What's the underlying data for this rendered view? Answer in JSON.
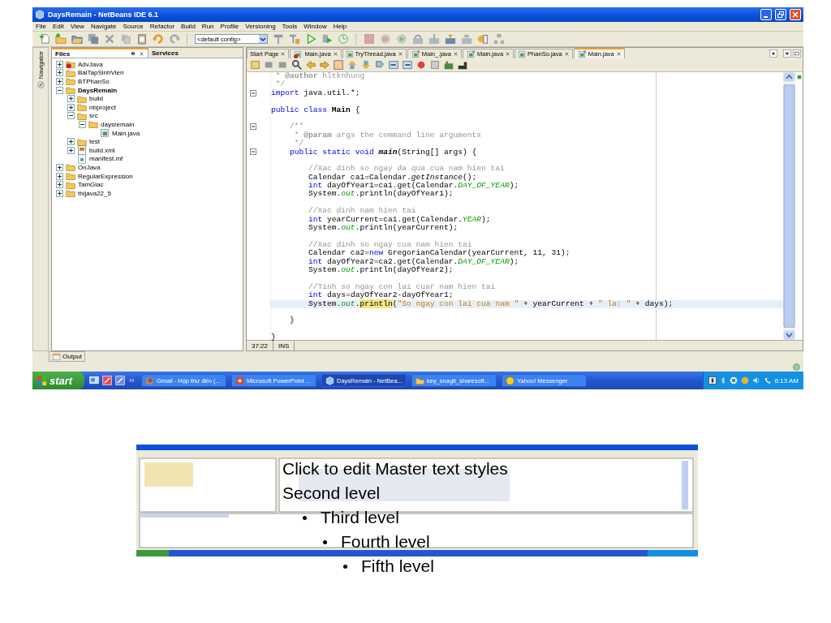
{
  "window": {
    "title": "DaysRemain - NetBeans IDE 6.1"
  },
  "menu": [
    "File",
    "Edit",
    "View",
    "Navigate",
    "Source",
    "Refactor",
    "Build",
    "Run",
    "Profile",
    "Versioning",
    "Tools",
    "Window",
    "Help"
  ],
  "toolbar": {
    "config": "<default config>"
  },
  "navigator": {
    "label": "Navigator"
  },
  "files_panel": {
    "tabs": [
      {
        "label": "Files",
        "selected": true
      },
      {
        "label": "Services",
        "selected": false
      }
    ],
    "tree": [
      {
        "label": "AdvJava",
        "kind": "error-project",
        "expanded": false
      },
      {
        "label": "BaiTapSinhVien",
        "kind": "project",
        "expanded": false
      },
      {
        "label": "BTPhanSo",
        "kind": "project",
        "expanded": false
      },
      {
        "label": "DaysRemain",
        "kind": "main-project",
        "expanded": true,
        "children": [
          {
            "label": "build",
            "kind": "folder",
            "expanded": false
          },
          {
            "label": "nbproject",
            "kind": "folder",
            "expanded": false
          },
          {
            "label": "src",
            "kind": "folder",
            "expanded": true,
            "children": [
              {
                "label": "daysremain",
                "kind": "folder",
                "expanded": true,
                "children": [
                  {
                    "label": "Main.java",
                    "kind": "java"
                  }
                ]
              }
            ]
          },
          {
            "label": "test",
            "kind": "folder",
            "expanded": false
          },
          {
            "label": "build.xml",
            "kind": "xml",
            "expanded": false
          },
          {
            "label": "manifest.mf",
            "kind": "manifest"
          }
        ]
      },
      {
        "label": "OnJava",
        "kind": "project",
        "expanded": false
      },
      {
        "label": "RegularExpression",
        "kind": "project",
        "expanded": false
      },
      {
        "label": "TamGiac",
        "kind": "project",
        "expanded": false
      },
      {
        "label": "thijava22_5",
        "kind": "project",
        "expanded": false
      }
    ]
  },
  "editor": {
    "tabs": [
      {
        "label": "Start Page",
        "kind": "page",
        "selected": false
      },
      {
        "label": "Main.java",
        "kind": "error-java",
        "selected": false
      },
      {
        "label": "TryThread.java",
        "kind": "java",
        "selected": false
      },
      {
        "label": "Main_.java",
        "kind": "run-java",
        "selected": false
      },
      {
        "label": "Main.java",
        "kind": "run-java",
        "selected": false
      },
      {
        "label": "PhanSo.java",
        "kind": "java",
        "selected": false
      },
      {
        "label": "Main.java",
        "kind": "run-java",
        "selected": true
      }
    ],
    "lines": [
      {
        "fold": false,
        "current": false,
        "segments": [
          {
            "kind": "comment",
            "text": " * "
          },
          {
            "kind": "doc-tag",
            "text": "@author"
          },
          {
            "kind": "comment",
            "text": " hltknhung"
          }
        ]
      },
      {
        "fold": false,
        "current": false,
        "segments": [
          {
            "kind": "comment",
            "text": " */"
          }
        ]
      },
      {
        "fold": true,
        "current": false,
        "segments": [
          {
            "kind": "keyword",
            "text": "import"
          },
          {
            "kind": "plain",
            "text": " java.util.*;"
          }
        ]
      },
      {
        "fold": false,
        "current": false
      },
      {
        "fold": false,
        "current": false,
        "segments": [
          {
            "kind": "keyword",
            "text": "public class "
          },
          {
            "kind": "bold",
            "text": "Main"
          },
          {
            "kind": "plain",
            "text": " {"
          }
        ]
      },
      {
        "fold": false,
        "current": false
      },
      {
        "fold": true,
        "current": false,
        "segments": [
          {
            "kind": "comment",
            "text": "    /**"
          }
        ]
      },
      {
        "fold": false,
        "current": false,
        "segments": [
          {
            "kind": "comment",
            "text": "     * "
          },
          {
            "kind": "doc-tag",
            "text": "@param"
          },
          {
            "kind": "comment",
            "text": " args the command line arguments"
          }
        ]
      },
      {
        "fold": false,
        "current": false,
        "segments": [
          {
            "kind": "comment",
            "text": "     */"
          }
        ]
      },
      {
        "fold": true,
        "current": false,
        "segments": [
          {
            "kind": "keyword",
            "text": "    public static void "
          },
          {
            "kind": "bold-italic",
            "text": "main"
          },
          {
            "kind": "plain",
            "text": "(String[] args) {"
          }
        ]
      },
      {
        "fold": false,
        "current": false
      },
      {
        "fold": false,
        "current": false,
        "segments": [
          {
            "kind": "comment",
            "text": "        //Xac dinh so ngay da qua cua nam hien tai"
          }
        ]
      },
      {
        "fold": false,
        "current": false,
        "segments": [
          {
            "kind": "plain",
            "text": "        Calendar ca1=Calendar."
          },
          {
            "kind": "italic",
            "text": "getInstance"
          },
          {
            "kind": "plain",
            "text": "();"
          }
        ]
      },
      {
        "fold": false,
        "current": false,
        "segments": [
          {
            "kind": "keyword",
            "text": "        int"
          },
          {
            "kind": "plain",
            "text": " dayOfYear1=ca1.get(Calendar."
          },
          {
            "kind": "field",
            "text": "DAY_OF_YEAR"
          },
          {
            "kind": "plain",
            "text": ");"
          }
        ]
      },
      {
        "fold": false,
        "current": false,
        "segments": [
          {
            "kind": "plain",
            "text": "        System."
          },
          {
            "kind": "field",
            "text": "out"
          },
          {
            "kind": "plain",
            "text": ".println(dayOfYear1);"
          }
        ]
      },
      {
        "fold": false,
        "current": false
      },
      {
        "fold": false,
        "current": false,
        "segments": [
          {
            "kind": "comment",
            "text": "        //Xac dinh nam hien tai"
          }
        ]
      },
      {
        "fold": false,
        "current": false,
        "segments": [
          {
            "kind": "keyword",
            "text": "        int"
          },
          {
            "kind": "plain",
            "text": " yearCurrent=ca1.get(Calendar."
          },
          {
            "kind": "field",
            "text": "YEAR"
          },
          {
            "kind": "plain",
            "text": ");"
          }
        ]
      },
      {
        "fold": false,
        "current": false,
        "segments": [
          {
            "kind": "plain",
            "text": "        System."
          },
          {
            "kind": "field",
            "text": "out"
          },
          {
            "kind": "plain",
            "text": ".println(yearCurrent);"
          }
        ]
      },
      {
        "fold": false,
        "current": false
      },
      {
        "fold": false,
        "current": false,
        "segments": [
          {
            "kind": "comment",
            "text": "        //Xac dinh so ngay cua nam hien tai"
          }
        ]
      },
      {
        "fold": false,
        "current": false,
        "segments": [
          {
            "kind": "plain",
            "text": "        Calendar ca2="
          },
          {
            "kind": "keyword",
            "text": "new"
          },
          {
            "kind": "plain",
            "text": " GregorianCalendar(yearCurrent, 11, 31);"
          }
        ]
      },
      {
        "fold": false,
        "current": false,
        "segments": [
          {
            "kind": "keyword",
            "text": "        int"
          },
          {
            "kind": "plain",
            "text": " dayOfYear2=ca2.get(Calendar."
          },
          {
            "kind": "field",
            "text": "DAY_OF_YEAR"
          },
          {
            "kind": "plain",
            "text": ");"
          }
        ]
      },
      {
        "fold": false,
        "current": false,
        "segments": [
          {
            "kind": "plain",
            "text": "        System."
          },
          {
            "kind": "field",
            "text": "out"
          },
          {
            "kind": "plain",
            "text": ".println(dayOfYear2);"
          }
        ]
      },
      {
        "fold": false,
        "current": false
      },
      {
        "fold": false,
        "current": false,
        "segments": [
          {
            "kind": "comment",
            "text": "        //Tinh so ngay con lai cuar nam hien tai"
          }
        ]
      },
      {
        "fold": false,
        "current": false,
        "segments": [
          {
            "kind": "keyword",
            "text": "        int"
          },
          {
            "kind": "plain",
            "text": " days=dayOfYear2-dayOfYear1;"
          }
        ]
      },
      {
        "fold": false,
        "current": true,
        "segments": [
          {
            "kind": "plain",
            "text": "        System."
          },
          {
            "kind": "field",
            "text": "out"
          },
          {
            "kind": "plain",
            "text": "."
          },
          {
            "kind": "mark",
            "text": "println"
          },
          {
            "kind": "plain",
            "text": "("
          },
          {
            "kind": "string",
            "text": "\"So ngay con lai cua nam \""
          },
          {
            "kind": "plain",
            "text": " + yearCurrent + "
          },
          {
            "kind": "string",
            "text": "\" la: \""
          },
          {
            "kind": "plain",
            "text": " + days);"
          }
        ]
      },
      {
        "fold": false,
        "current": false
      },
      {
        "fold": false,
        "current": false,
        "segments": [
          {
            "kind": "plain",
            "text": "    }"
          }
        ]
      },
      {
        "fold": false,
        "current": false
      },
      {
        "fold": false,
        "current": false,
        "segments": [
          {
            "kind": "plain",
            "text": "}"
          }
        ]
      }
    ],
    "status": {
      "position": "37:22",
      "mode": "INS"
    }
  },
  "output": {
    "label": "Output"
  },
  "taskbar": {
    "start": "start",
    "tasks": [
      {
        "label": "Gmail - Hộp thư đến (...",
        "kind": "browser",
        "selected": false
      },
      {
        "label": "Microsoft PowerPoint ...",
        "kind": "slides",
        "selected": false
      },
      {
        "label": "DaysRemain - NetBea...",
        "kind": "ide",
        "selected": true
      },
      {
        "label": "key_snagit_sharesoft...",
        "kind": "folder",
        "selected": false
      },
      {
        "label": "Yahoo! Messenger",
        "kind": "messenger",
        "selected": false
      }
    ],
    "clock": "6:13 AM"
  },
  "slide_text": [
    {
      "text": "Click to edit Master text styles",
      "kind": "plain"
    },
    {
      "text": "Second level",
      "kind": "plain",
      "children": [
        {
          "text": "Third level",
          "kind": "bullet",
          "children": [
            {
              "text": "Fourth level",
              "kind": "bullet",
              "children": [
                {
                  "text": "Fifth level",
                  "kind": "bullet"
                }
              ]
            }
          ]
        }
      ]
    }
  ]
}
